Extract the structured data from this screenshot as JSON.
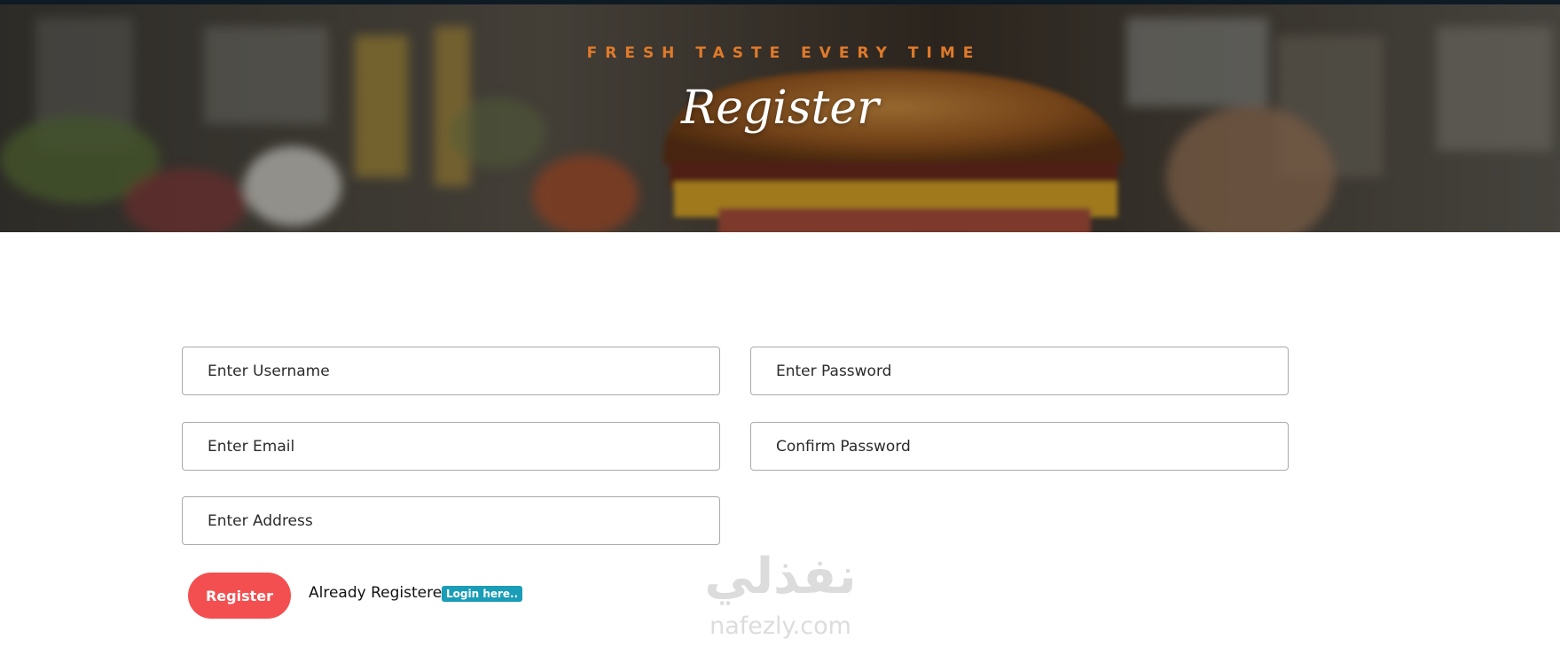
{
  "hero": {
    "tagline": "FRESH TASTE EVERY TIME",
    "title": "Register",
    "tagline_color": "#e07a2b"
  },
  "form": {
    "username_placeholder": "Enter Username",
    "password_placeholder": "Enter Password",
    "email_placeholder": "Enter Email",
    "confirm_placeholder": "Confirm Password",
    "address_placeholder": "Enter Address",
    "register_label": "Register",
    "already_text": "Already Registered?",
    "login_label": "Login here..",
    "register_color": "#f44f50",
    "login_color": "#1a9db8"
  },
  "watermark": {
    "arabic": "نفذلي",
    "latin": "nafezly.com"
  }
}
